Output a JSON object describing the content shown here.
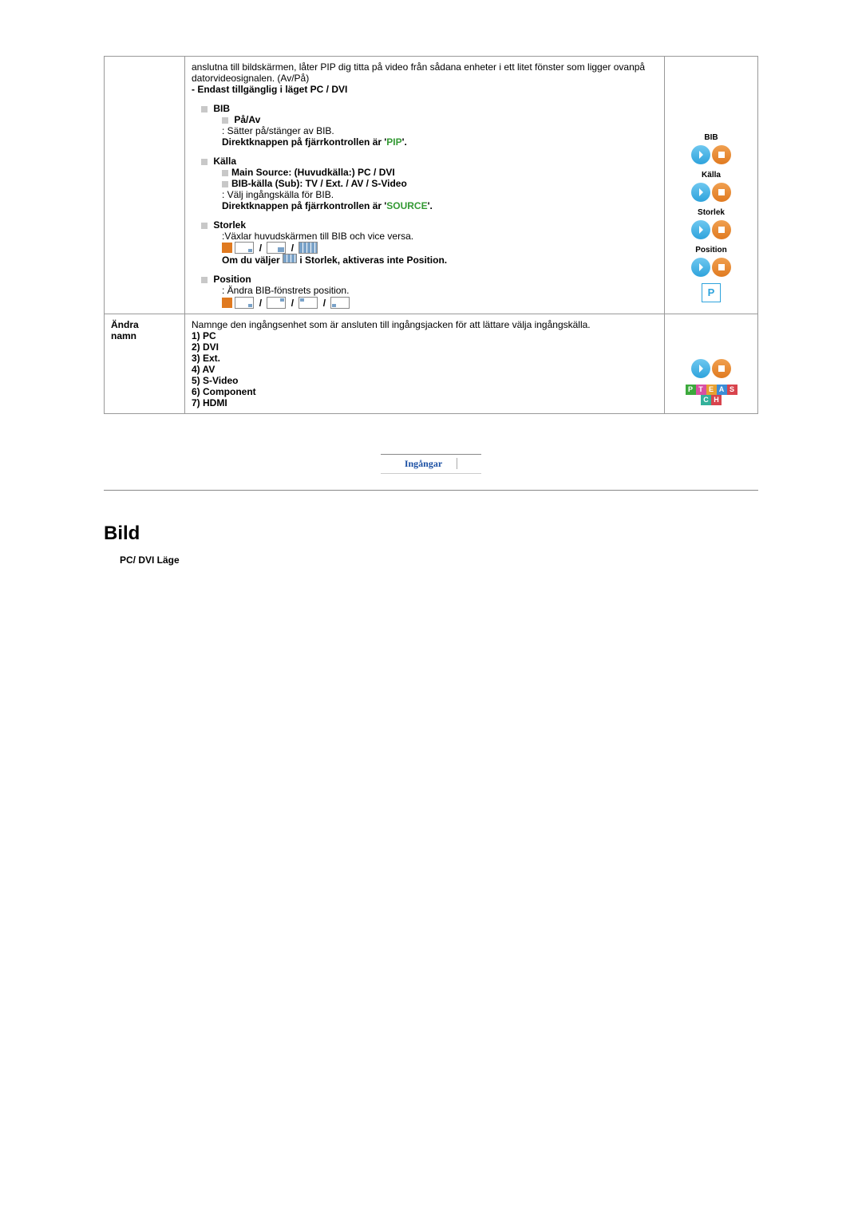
{
  "row1": {
    "intro": "anslutna till bildskärmen, låter PIP dig titta på video från sådana enheter i ett litet fönster som ligger ovanpå datorvideosignalen. (Av/På)",
    "availability": "- Endast tillgänglig i läget PC / DVI",
    "bib": {
      "title": "BIB",
      "paav_label": "På/Av",
      "paav_desc": ": Sätter på/stänger av BIB.",
      "direct_pre": "Direktknappen på fjärrkontrollen är '",
      "direct_key": "PIP",
      "direct_post": "'."
    },
    "kalla": {
      "title": "Källa",
      "main": "Main Source: (Huvudkälla:) PC / DVI",
      "sub": "BIB-källa (Sub): TV / Ext. / AV / S-Video",
      "desc": ": Välj ingångskälla för BIB.",
      "direct_pre": "Direktknappen på fjärrkontrollen är '",
      "direct_key": "SOURCE",
      "direct_post": "'."
    },
    "storlek": {
      "title": "Storlek",
      "desc": ":Växlar huvudskärmen till BIB och vice versa.",
      "note_pre": "Om du väljer ",
      "note_post": " i Storlek, aktiveras inte Position."
    },
    "position": {
      "title": "Position",
      "desc": ": Ändra BIB-fönstrets position."
    },
    "labels": {
      "bib": "BIB",
      "kalla": "Källa",
      "storlek": "Storlek",
      "position": "Position",
      "p": "P"
    }
  },
  "row2": {
    "left": "Ändra\nnamn",
    "intro": "Namnge den ingångsenhet som är ansluten till ingångsjacken för att lättare välja ingångskälla.",
    "items": [
      "1) PC",
      "2) DVI",
      "3) Ext.",
      "4) AV",
      "5) S-Video",
      "6) Component",
      "7) HDMI"
    ]
  },
  "tabs": {
    "tab1": "Ingångar"
  },
  "section": {
    "title": "Bild",
    "mode": "PC/ DVI Läge"
  }
}
